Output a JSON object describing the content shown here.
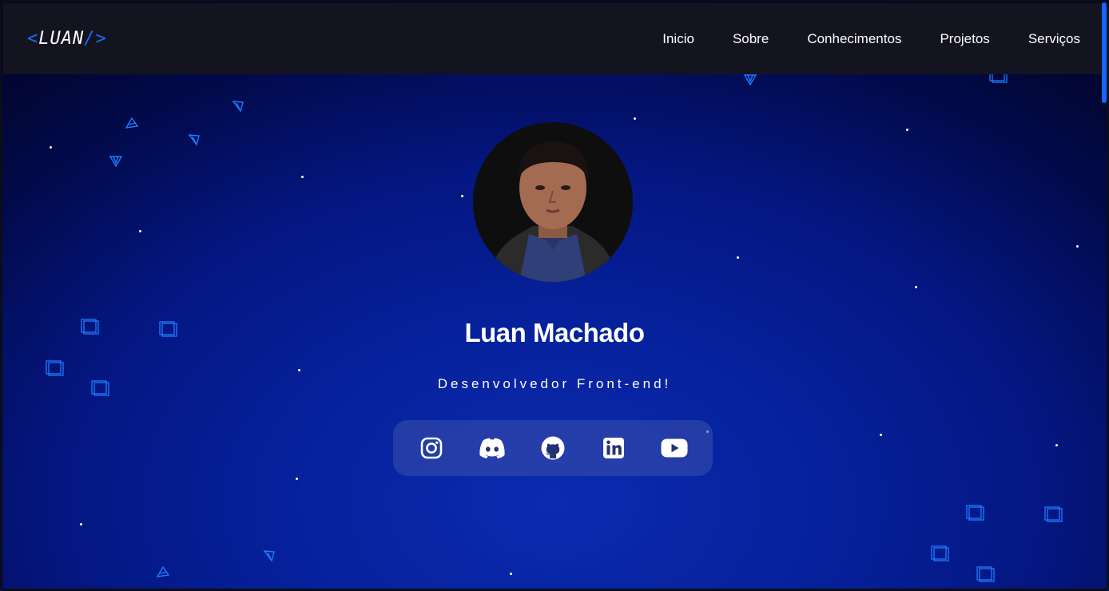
{
  "header": {
    "logo": {
      "open": "<",
      "text": "LUAN",
      "close": "/>"
    },
    "nav": [
      "Inicio",
      "Sobre",
      "Conhecimentos",
      "Projetos",
      "Serviços"
    ]
  },
  "hero": {
    "name": "Luan Machado",
    "role": "Desenvolvedor Front-end!"
  },
  "social": [
    "instagram-icon",
    "discord-icon",
    "github-icon",
    "linkedin-icon",
    "youtube-icon"
  ],
  "colors": {
    "accent": "#1a6dff",
    "header_bg": "#13141f",
    "text": "#ffffff"
  }
}
